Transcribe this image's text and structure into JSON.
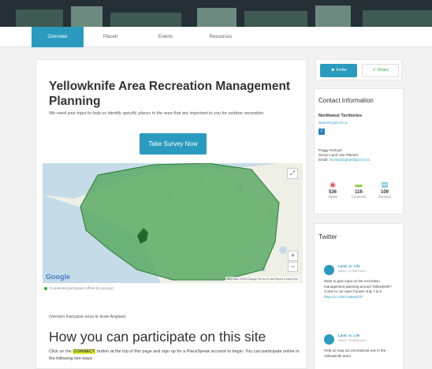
{
  "tabs": [
    {
      "label": "Overview",
      "active": true
    },
    {
      "label": "PlaceIt",
      "active": false
    },
    {
      "label": "Events",
      "active": false
    },
    {
      "label": "Resources",
      "active": false
    }
  ],
  "main": {
    "title": "Yellowknife Area Recreation Management Planning",
    "intro": "We need your input to help us identify specific places in the area that are important to you for outdoor recreation.",
    "survey_button": "Take Survey Now",
    "map": {
      "expand_icon": "expand-icon",
      "zoom_in": "+",
      "zoom_out": "−",
      "google_label": "Google",
      "attribution": "Map data ©2016 Google   Terms of Use   Report a map error",
      "colors": {
        "water": "#c5dce8",
        "land": "#eef0e6",
        "region": "#5aaa64",
        "highlight": "#1f6a2a"
      }
    },
    "legend_note": "Connected participant (offset for privacy)",
    "version_note": "(Version française sous le texte Anglais)",
    "section_heading": "How you can participate on this site",
    "body_before": "Click on the ",
    "body_highlight": "CONNECT",
    "body_after": " button at the top of this page and sign up for a PlaceSpeak account to begin.  You can participate online in the following two ways:"
  },
  "actions": {
    "invite_label": "Invite",
    "share_label": "Share"
  },
  "contact": {
    "heading": "Contact Information",
    "org": "Northwest Territories",
    "website": "www.enr.gov.nt.ca",
    "person_name": "Peggy Holroyd",
    "person_title": "Senior Land Use Planner",
    "person_email_label": "Email:",
    "person_email": "recreationplan@gov.nt.ca",
    "stats": [
      {
        "icon": "eye-icon",
        "glyph": "◉",
        "value": "536",
        "label": "Views",
        "color": "#d9534f"
      },
      {
        "icon": "connect-icon",
        "glyph": "▬",
        "value": "116",
        "label": "Connects",
        "color": "#8cc63f"
      },
      {
        "icon": "survey-icon",
        "glyph": "▤",
        "value": "109",
        "label": "Surveys",
        "color": "#2a9bbf"
      }
    ]
  },
  "twitter": {
    "heading": "Twitter",
    "tweets": [
      {
        "handle": "Land_is_Life",
        "time": "ABOUT 14 DAYS AGO",
        "text": "Want to give input on the recreation management planning around Yellowknife? Come to our open houses July 7 & 8 ",
        "link": "https://t.co/NzCN8wjOJP"
      },
      {
        "handle": "Land_is_Life",
        "time": "ABOUT 30 DAYS AGO",
        "text": "Help us map out recreational use in the Yellowknife area!",
        "link": ""
      }
    ]
  }
}
